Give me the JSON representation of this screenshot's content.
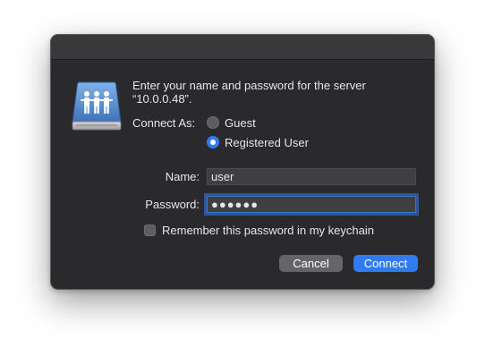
{
  "dialog": {
    "message_line1": "Enter your name and password for the server",
    "message_line2": "“10.0.0.48”.",
    "connect_as_label": "Connect As:",
    "options": [
      {
        "label": "Guest",
        "selected": false
      },
      {
        "label": "Registered User",
        "selected": true
      }
    ],
    "name_label": "Name:",
    "name_value": "user",
    "password_label": "Password:",
    "password_value": "●●●●●●",
    "remember_label": "Remember this password in my keychain",
    "remember_checked": false,
    "cancel_label": "Cancel",
    "connect_label": "Connect"
  },
  "icons": {
    "server": "shared-server-icon"
  },
  "colors": {
    "dialog_background": "#2a2a2c",
    "accent": "#2f7bf1",
    "secondary_button": "#656568"
  }
}
